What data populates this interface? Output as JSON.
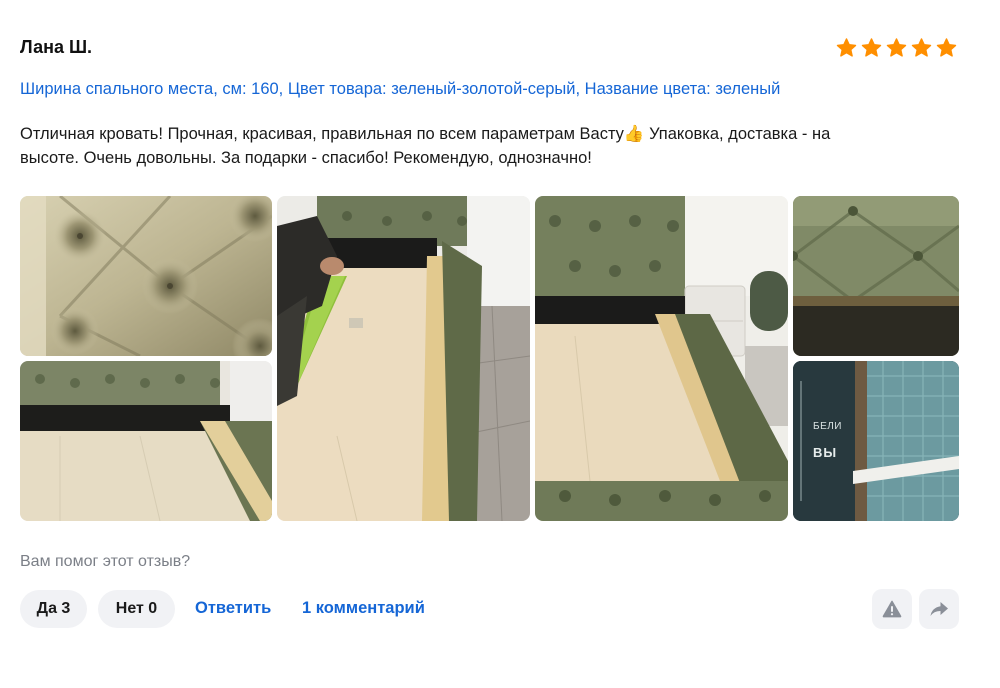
{
  "review": {
    "author": "Лана Ш.",
    "rating": 5,
    "rating_max": 5,
    "params": "Ширина спального места, см: 160, Цвет товара: зеленый-золотой-серый, Название цвета: зеленый",
    "text_line1": "Отличная кровать! Прочная, красивая, правильная по всем параметрам Васту👍 Упаковка, доставка - на",
    "text_line2": "высоте. Очень довольны. За подарки - спасибо! Рекомендую, однозначно!",
    "photo_caption_fragment_1": "БЕЛИ",
    "photo_caption_fragment_2": "ВЫ"
  },
  "feedback": {
    "question": "Вам помог этот отзыв?",
    "yes_label": "Да 3",
    "no_label": "Нет 0",
    "reply_label": "Ответить",
    "comments_label": "1 комментарий"
  },
  "icons": {
    "star": "star-icon",
    "report": "warning-triangle-icon",
    "share": "share-arrow-icon"
  },
  "colors": {
    "star": "#ff8f00",
    "link": "#1566d6",
    "muted": "#7b7f87",
    "button_bg": "#f1f2f5"
  }
}
